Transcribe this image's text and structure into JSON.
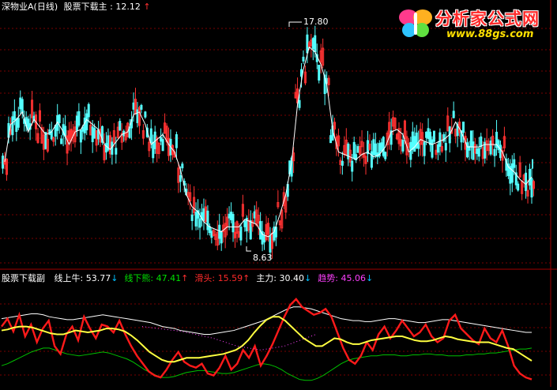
{
  "upper": {
    "title": "深物业A(日线)",
    "indicator_label": "股票下载主",
    "indicator_value": "12.12",
    "indicator_arrow": "↑",
    "high_label": "17.80",
    "low_label": "8.63"
  },
  "lower": {
    "title": "股票下载副",
    "items": [
      {
        "label": "线上牛:",
        "value": "53.77",
        "arrow": "↓",
        "color": "#ffffff",
        "arrow_color": "#00c0ff"
      },
      {
        "label": "线下熊:",
        "value": "47.41",
        "arrow": "↑",
        "color": "#00e000",
        "arrow_color": "#ff3030"
      },
      {
        "label": "滑头:",
        "value": "15.59",
        "arrow": "↑",
        "color": "#ff2a2a",
        "arrow_color": "#ff3030"
      },
      {
        "label": "主力:",
        "value": "30.40",
        "arrow": "↓",
        "color": "#ffffff",
        "arrow_color": "#00c0ff"
      },
      {
        "label": "趋势:",
        "value": "45.06",
        "arrow": "↓",
        "color": "#ff40ff",
        "arrow_color": "#00c0ff"
      }
    ]
  },
  "watermark": {
    "name": "分析家公式网",
    "url": "www.88gs.com"
  },
  "colors": {
    "up": "#ff3232",
    "down": "#54ffff",
    "price_line": "#ffffff",
    "grid": "#7a0000",
    "bull": "#ffffff",
    "bear": "#00c000",
    "slick": "#ff1a1a",
    "main": "#ffff40",
    "trend": "#ff40ff"
  },
  "chart_data": [
    {
      "type": "line",
      "title": "深物业A(日线)",
      "series": [
        {
          "name": "股票下载主",
          "values": [
            12.2,
            13.7,
            13.9,
            14.2,
            13.4,
            13.9,
            13.6,
            13.3,
            13.4,
            13.8,
            13.4,
            12.9,
            13.4,
            13.5,
            13.9,
            13.7,
            13.5,
            12.9,
            12.7,
            13.0,
            13.3,
            13.4,
            14.1,
            14.2,
            13.7,
            12.9,
            13.1,
            13.3,
            12.9,
            12.6,
            11.9,
            10.9,
            10.4,
            10.2,
            9.8,
            9.6,
            9.5,
            9.4,
            9.6,
            9.6,
            9.6,
            9.9,
            9.8,
            9.7,
            9.3,
            9.2,
            9.4,
            10.1,
            10.9,
            12.2,
            14.5,
            15.9,
            16.8,
            16.6,
            16.1,
            15.3,
            13.5,
            12.6,
            12.5,
            12.4,
            12.3,
            12.5,
            12.6,
            12.4,
            12.5,
            12.8,
            13.4,
            13.5,
            13.3,
            12.6,
            12.8,
            13.1,
            13.0,
            12.9,
            13.0,
            13.1,
            13.3,
            13.8,
            13.4,
            12.8,
            12.8,
            12.8,
            12.9,
            12.9,
            12.9,
            12.6,
            12.0,
            11.8,
            11.5,
            11.3,
            11.6
          ]
        }
      ],
      "labels": {
        "high": 17.8,
        "low": 8.63,
        "last": 12.12
      }
    },
    {
      "type": "line",
      "title": "股票下载副",
      "series": [
        {
          "name": "线上牛",
          "values": [
            68,
            69,
            70,
            71,
            72,
            73,
            73,
            72,
            70,
            69,
            68,
            67,
            67,
            68,
            69,
            70,
            71,
            72,
            71,
            70,
            69,
            68,
            67,
            66,
            65,
            64,
            62,
            60,
            59,
            58,
            56,
            55,
            54,
            53,
            52,
            52,
            53,
            54,
            55,
            56,
            58,
            60,
            62,
            64,
            66,
            69,
            72,
            75,
            78,
            80,
            80,
            79,
            78,
            76,
            74,
            72,
            70,
            68,
            67,
            66,
            66,
            65,
            65,
            66,
            67,
            68,
            68,
            67,
            66,
            65,
            64,
            64,
            65,
            66,
            67,
            67,
            66,
            65,
            64,
            63,
            62,
            61,
            60,
            59,
            58,
            57,
            56,
            55,
            54,
            54
          ]
        },
        {
          "name": "线下熊",
          "values": [
            20,
            22,
            25,
            28,
            31,
            34,
            36,
            38,
            38,
            36,
            34,
            32,
            31,
            30,
            31,
            32,
            33,
            34,
            33,
            31,
            29,
            27,
            24,
            20,
            16,
            13,
            10,
            8,
            8,
            9,
            11,
            13,
            14,
            15,
            15,
            14,
            13,
            12,
            12,
            13,
            15,
            17,
            19,
            21,
            22,
            21,
            19,
            16,
            12,
            9,
            6,
            5,
            5,
            7,
            10,
            14,
            18,
            22,
            25,
            27,
            28,
            29,
            30,
            30,
            31,
            31,
            31,
            30,
            30,
            31,
            31,
            32,
            32,
            31,
            31,
            30,
            30,
            30,
            31,
            31,
            32,
            32,
            33,
            33,
            34,
            35,
            36,
            37,
            37,
            38
          ]
        },
        {
          "name": "滑头",
          "values": [
            60,
            68,
            55,
            72,
            50,
            62,
            44,
            58,
            66,
            40,
            32,
            52,
            60,
            46,
            70,
            58,
            48,
            62,
            60,
            54,
            66,
            52,
            40,
            30,
            22,
            14,
            10,
            8,
            16,
            26,
            34,
            24,
            20,
            18,
            22,
            12,
            10,
            18,
            30,
            16,
            22,
            36,
            28,
            40,
            20,
            30,
            42,
            56,
            70,
            82,
            88,
            80,
            76,
            72,
            74,
            78,
            70,
            54,
            38,
            26,
            22,
            30,
            44,
            36,
            52,
            60,
            48,
            56,
            66,
            58,
            50,
            54,
            62,
            50,
            44,
            48,
            66,
            72,
            58,
            52,
            46,
            42,
            58,
            48,
            44,
            56,
            40,
            20,
            12,
            8,
            6
          ]
        },
        {
          "name": "主力",
          "values": [
            56,
            57,
            59,
            60,
            60,
            59,
            57,
            55,
            53,
            52,
            52,
            54,
            56,
            55,
            54,
            55,
            56,
            58,
            58,
            57,
            55,
            51,
            46,
            40,
            34,
            30,
            26,
            24,
            24,
            26,
            28,
            28,
            28,
            29,
            30,
            31,
            32,
            34,
            36,
            40,
            46,
            54,
            61,
            67,
            70,
            70,
            66,
            60,
            54,
            48,
            44,
            40,
            40,
            44,
            48,
            47,
            44,
            42,
            42,
            44,
            46,
            47,
            48,
            49,
            50,
            50,
            48,
            46,
            45,
            45,
            46,
            48,
            50,
            49,
            47,
            46,
            45,
            44,
            44,
            44,
            42,
            40,
            38,
            37,
            33,
            29,
            25
          ]
        }
      ],
      "ylim": [
        0,
        100
      ]
    }
  ]
}
